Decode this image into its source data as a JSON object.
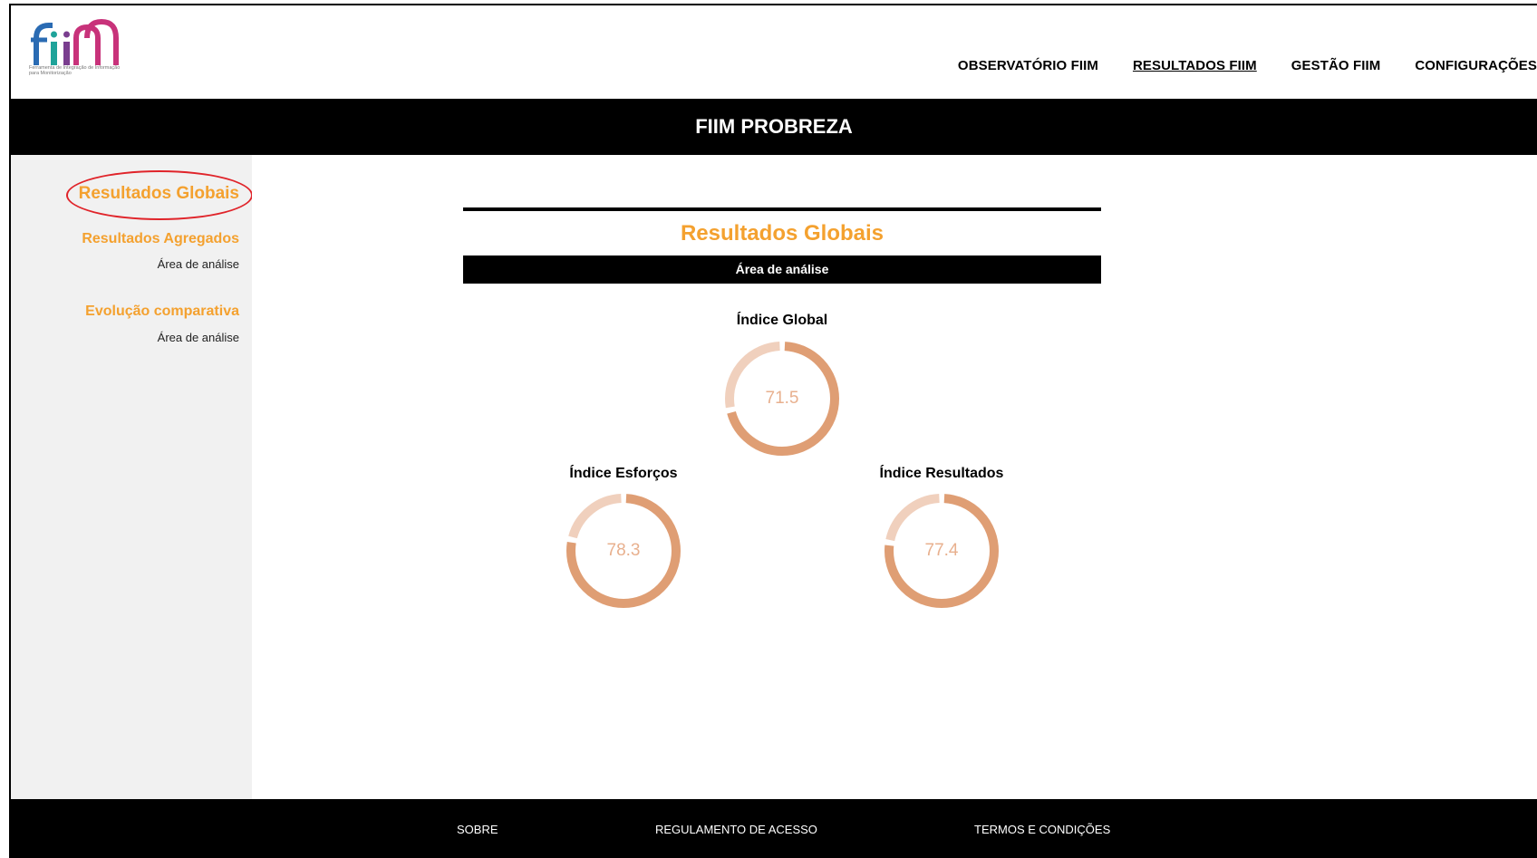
{
  "brand": {
    "logo_text": "fiim",
    "logo_subtitle": "Ferramenta de Integração de Informação para Monitorização",
    "colors": {
      "blue": "#2a6bb3",
      "teal": "#1fa39a",
      "purple": "#7a3e8f",
      "pink": "#c8327a"
    }
  },
  "nav": {
    "items": [
      {
        "label": "OBSERVATÓRIO FIIM",
        "active": false
      },
      {
        "label": "RESULTADOS FIIM",
        "active": true
      },
      {
        "label": "GESTÃO FIIM",
        "active": false
      },
      {
        "label": "CONFIGURAÇÕES",
        "active": false
      }
    ]
  },
  "banner": {
    "title": "FIIM PROBREZA"
  },
  "sidebar": {
    "items": [
      {
        "label": "Resultados Globais"
      },
      {
        "label": "Resultados Agregados"
      },
      {
        "label": "Área de análise"
      },
      {
        "label": "Evolução comparativa"
      },
      {
        "label": "Área de análise"
      }
    ]
  },
  "main": {
    "title": "Resultados Globais",
    "area_label": "Área de análise",
    "gauges": [
      {
        "label": "Índice Global",
        "value": "71.5",
        "fraction": 0.715
      },
      {
        "label": "Índice Esforços",
        "value": "78.3",
        "fraction": 0.783
      },
      {
        "label": "Índice Resultados",
        "value": "77.4",
        "fraction": 0.774
      }
    ]
  },
  "footer": {
    "links": [
      {
        "label": "SOBRE"
      },
      {
        "label": "REGULAMENTO DE ACESSO"
      },
      {
        "label": "TERMOS E CONDIÇÕES"
      }
    ]
  },
  "colors": {
    "accent": "#f4a12f",
    "gauge_fill": "#df9e74",
    "gauge_track": "#f0d0bd",
    "highlight_ring": "#e0242a"
  }
}
